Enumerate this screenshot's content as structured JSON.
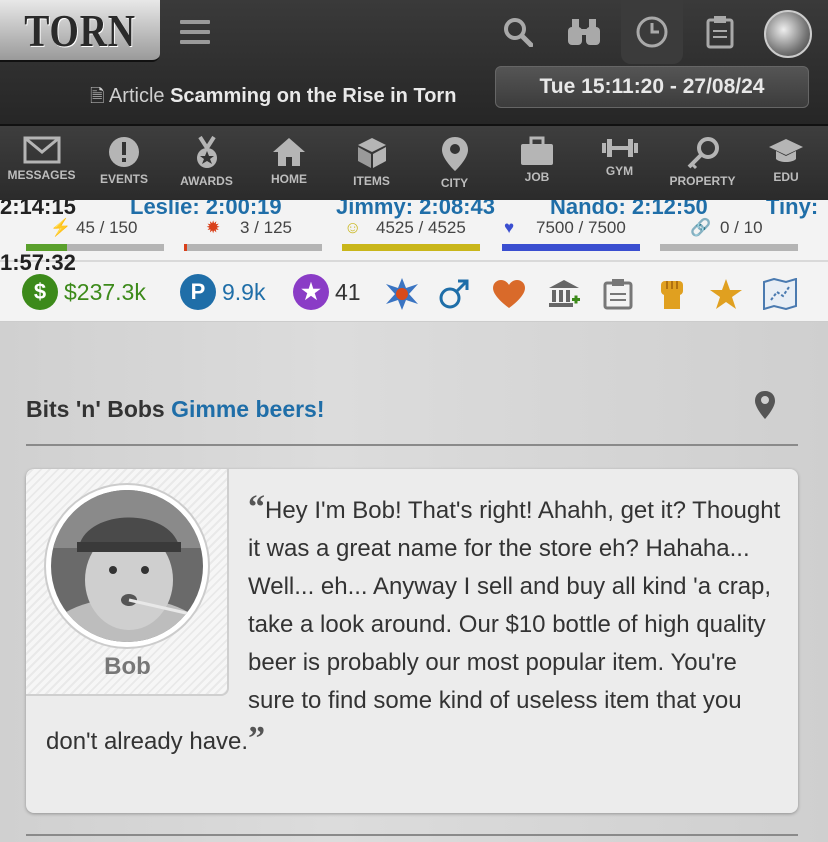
{
  "header": {
    "logo": "TORN",
    "article_prefix": "Article",
    "article_title": "Scamming on the Rise in Torn",
    "datetime": "Tue 15:11:20 - 27/08/24"
  },
  "top_icons": [
    "search-icon",
    "binoculars-icon",
    "clock-icon",
    "clipboard-icon",
    "avatar"
  ],
  "nav": [
    {
      "label": "MESSAGES",
      "icon": "envelope-icon"
    },
    {
      "label": "EVENTS",
      "icon": "exclamation-icon"
    },
    {
      "label": "AWARDS",
      "icon": "medal-icon"
    },
    {
      "label": "HOME",
      "icon": "house-icon"
    },
    {
      "label": "ITEMS",
      "icon": "box-icon"
    },
    {
      "label": "CITY",
      "icon": "pin-icon"
    },
    {
      "label": "JOB",
      "icon": "briefcase-icon"
    },
    {
      "label": "GYM",
      "icon": "dumbbell-icon"
    },
    {
      "label": "PROPERTY",
      "icon": "key-icon"
    },
    {
      "label": "EDU",
      "icon": "grad-cap-icon"
    }
  ],
  "timers": {
    "first": "2:14:15",
    "leslie": "Leslie: 2:00:19",
    "jimmy": "Jimmy: 2:08:43",
    "nando": "Nando: 2:12:50",
    "tiny": "Tiny:",
    "last": "1:57:32"
  },
  "bars": [
    {
      "name": "energy",
      "value": "45 / 150",
      "fraction": 0.3,
      "color": "#5aa02c"
    },
    {
      "name": "nerve",
      "value": "3 / 125",
      "fraction": 0.024,
      "color": "#d9401a"
    },
    {
      "name": "happy",
      "value": "4525 / 4525",
      "fraction": 1.0,
      "color": "#c9b61a"
    },
    {
      "name": "life",
      "value": "7500 / 7500",
      "fraction": 1.0,
      "color": "#3a4ed0"
    },
    {
      "name": "chain",
      "value": "0 / 10",
      "fraction": 0.0,
      "color": "#999999"
    }
  ],
  "currency": {
    "money": "$237.3k",
    "points": "9.9k",
    "merits": "41"
  },
  "status_icons": [
    "faction-icon",
    "male-icon",
    "heart-icon",
    "bank-icon",
    "clipboard-icon",
    "fist-icon",
    "star-icon",
    "map-icon"
  ],
  "store": {
    "name": "Bits 'n' Bobs",
    "tagline": "Gimme beers!",
    "npc_name": "Bob",
    "quote_open": "“",
    "quote_close": "”",
    "speech": "Hey I'm Bob! That's right! Ahahh, get it? Thought it was a great name for the store eh? Hahaha... Well... eh... Anyway I sell and buy all kind 'a crap, take a look around. Our $10 bottle of high quality beer is probably our most popular item. You're sure to find some kind of useless item that you don't already have."
  },
  "colors": {
    "money": "#3c8a1a",
    "points": "#1f6ea8",
    "accent_link": "#1f6ea8"
  }
}
